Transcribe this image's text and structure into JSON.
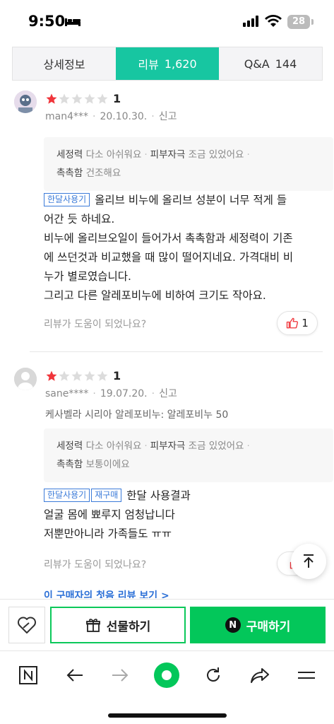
{
  "status_bar": {
    "time": "9:50",
    "battery": "28"
  },
  "tabs": [
    {
      "label": "상세정보",
      "count": ""
    },
    {
      "label": "리뷰",
      "count": "1,620"
    },
    {
      "label": "Q&A",
      "count": "144"
    }
  ],
  "reviews": [
    {
      "rating": "1",
      "user": "man4***",
      "date": "20.10.30.",
      "report": "신고",
      "attrs": {
        "a1_label": "세정력",
        "a1_value": "다소 아쉬워요",
        "a2_label": "피부자극",
        "a2_value": "조금 있었어요",
        "a3_label": "촉촉함",
        "a3_value": "건조해요"
      },
      "badges": [
        "한달사용기"
      ],
      "text_line1": "올리브 비누에 올리브 성분이 너무 적게 들",
      "text_rest": [
        "어간 듯 하네요.",
        "비누에 올리브오일이 들어가서 촉촉함과 세정력이 기존",
        "에 쓰던것과 비교했을 때 많이 떨어지네요. 가격대비 비",
        "누가 별로였습니다.",
        "그리고 다른 알레포비누에 비하여 크기도 작아요."
      ],
      "helpful_prompt": "리뷰가 도움이 되었나요?",
      "likes": "1"
    },
    {
      "rating": "1",
      "user": "sane****",
      "date": "19.07.20.",
      "report": "신고",
      "option": "케사벨라 시리아 알레포비누: 알레포비누 50",
      "attrs": {
        "a1_label": "세정력",
        "a1_value": "다소 아쉬워요",
        "a2_label": "피부자극",
        "a2_value": "조금 있었어요",
        "a3_label": "촉촉함",
        "a3_value": "보통이에요"
      },
      "badges": [
        "한달사용기",
        "재구매"
      ],
      "text_line1": "한달 사용결과",
      "text_rest": [
        "얼굴 몸에 뾰루지 엄청납니다",
        "저뿐만아니라 가족들도 ㅠㅠ"
      ],
      "helpful_prompt": "리뷰가 도움이 되었나요?"
    }
  ],
  "first_review_link": "이 구매자의 첫음 리뷰 보기 >",
  "buy_bar": {
    "gift_label": "선물하기",
    "buy_label": "구매하기",
    "n_logo": "N"
  },
  "colors": {
    "accent": "#17c6a1",
    "naver_green": "#03c75a",
    "star_red": "#f0353b",
    "link_blue": "#2b6fd6"
  }
}
